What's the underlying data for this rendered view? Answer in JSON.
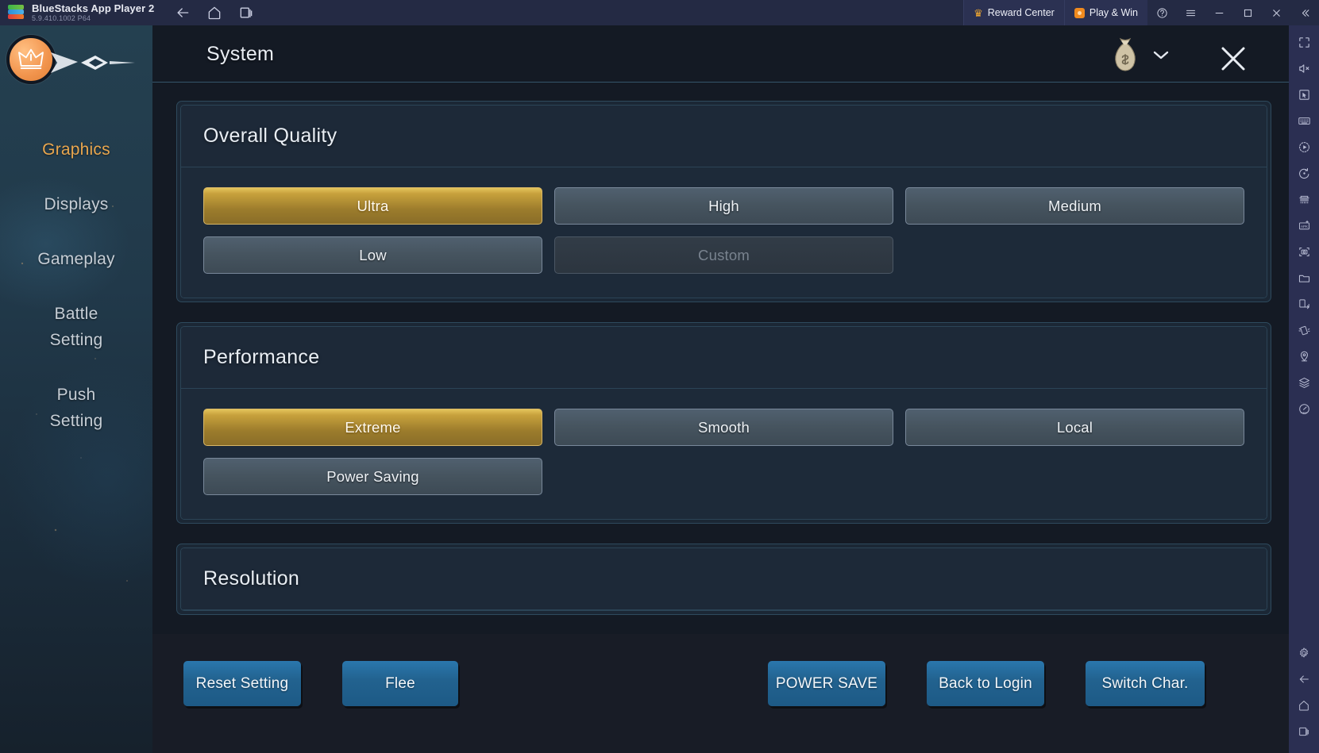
{
  "titlebar": {
    "app_name": "BlueStacks App Player 2",
    "version": "5.9.410.1002  P64",
    "nav": [
      {
        "name": "back-icon",
        "label": "Back"
      },
      {
        "name": "home-icon",
        "label": "Home"
      },
      {
        "name": "recents-icon",
        "label": "Recent Apps"
      }
    ],
    "reward_center": "Reward Center",
    "play_and_win": "Play & Win",
    "window_buttons": [
      "help-icon",
      "menu-icon",
      "minimize-icon",
      "maximize-icon",
      "close-icon",
      "collapse-icon"
    ]
  },
  "rail": {
    "items": [
      "fullscreen-icon",
      "mute-icon",
      "pointer-icon",
      "keyboard-icon",
      "macro-record-icon",
      "rotate-icon",
      "multi-instance-icon",
      "install-apk-icon",
      "screenshot-icon",
      "media-folder-icon",
      "rotate-device-icon",
      "shake-icon",
      "location-icon",
      "layers-icon",
      "gamepad-icon"
    ],
    "bottom_items": [
      "settings-gear-icon",
      "back-icon",
      "home-icon",
      "recents-icon"
    ]
  },
  "sidebar": {
    "logo_name": "crown-logo",
    "items": [
      {
        "label": "Graphics",
        "active": true
      },
      {
        "label": "Displays",
        "active": false
      },
      {
        "label": "Gameplay",
        "active": false
      },
      {
        "label": "Battle Setting",
        "line1": "Battle",
        "line2": "Setting",
        "active": false
      },
      {
        "label": "Push Setting",
        "line1": "Push",
        "line2": "Setting",
        "active": false
      }
    ]
  },
  "header": {
    "title": "System",
    "currency_icon": "money-bag-icon",
    "dropdown_icon": "chevron-down-icon",
    "close_icon": "close-icon"
  },
  "sections": [
    {
      "title": "Overall Quality",
      "options": [
        {
          "label": "Ultra",
          "state": "selected"
        },
        {
          "label": "High",
          "state": "normal"
        },
        {
          "label": "Medium",
          "state": "normal"
        },
        {
          "label": "Low",
          "state": "normal"
        },
        {
          "label": "Custom",
          "state": "disabled"
        }
      ]
    },
    {
      "title": "Performance",
      "options": [
        {
          "label": "Extreme",
          "state": "selected"
        },
        {
          "label": "Smooth",
          "state": "normal"
        },
        {
          "label": "Local",
          "state": "normal"
        },
        {
          "label": "Power Saving",
          "state": "normal"
        }
      ]
    },
    {
      "title": "Resolution",
      "options": [],
      "clipped": true
    }
  ],
  "footer": {
    "reset_setting": "Reset Setting",
    "flee": "Flee",
    "power_save": "POWER SAVE",
    "back_to_login": "Back to Login",
    "switch_char": "Switch Char."
  },
  "colors": {
    "accent_gold": "#c7a13c",
    "accent_orange": "#e8a64e",
    "button_blue": "#22628f",
    "panel_bg": "#1d2a39",
    "titlebar_bg": "#242a44",
    "rail_bg": "#2b2f52"
  }
}
